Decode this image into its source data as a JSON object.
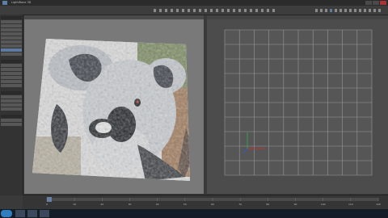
{
  "window": {
    "title": "LightWave 3D"
  },
  "menu_tabs": [],
  "sidebar": {
    "groups": [
      {
        "header": "",
        "items": [
          "",
          "",
          "",
          "",
          "",
          "",
          "",
          "",
          ""
        ]
      },
      {
        "header": "",
        "items": [
          "",
          "",
          "",
          "",
          "",
          ""
        ]
      },
      {
        "header": "",
        "items": [
          "",
          "",
          "",
          ""
        ]
      },
      {
        "header": "",
        "items": [
          "",
          ""
        ]
      }
    ]
  },
  "viewports": {
    "left": {
      "title": "",
      "texture": "koala-photo"
    },
    "right": {
      "title": ""
    }
  },
  "timeline": {
    "frames": [
      "0",
      "10",
      "20",
      "30",
      "40",
      "50",
      "60",
      "70",
      "80",
      "90",
      "100",
      "110",
      "120"
    ]
  },
  "taskbar": {
    "clock": ""
  },
  "colors": {
    "accent": "#5d7aa0",
    "axis_x": "#c03030",
    "axis_y": "#30a050",
    "axis_z": "#3060c0"
  }
}
